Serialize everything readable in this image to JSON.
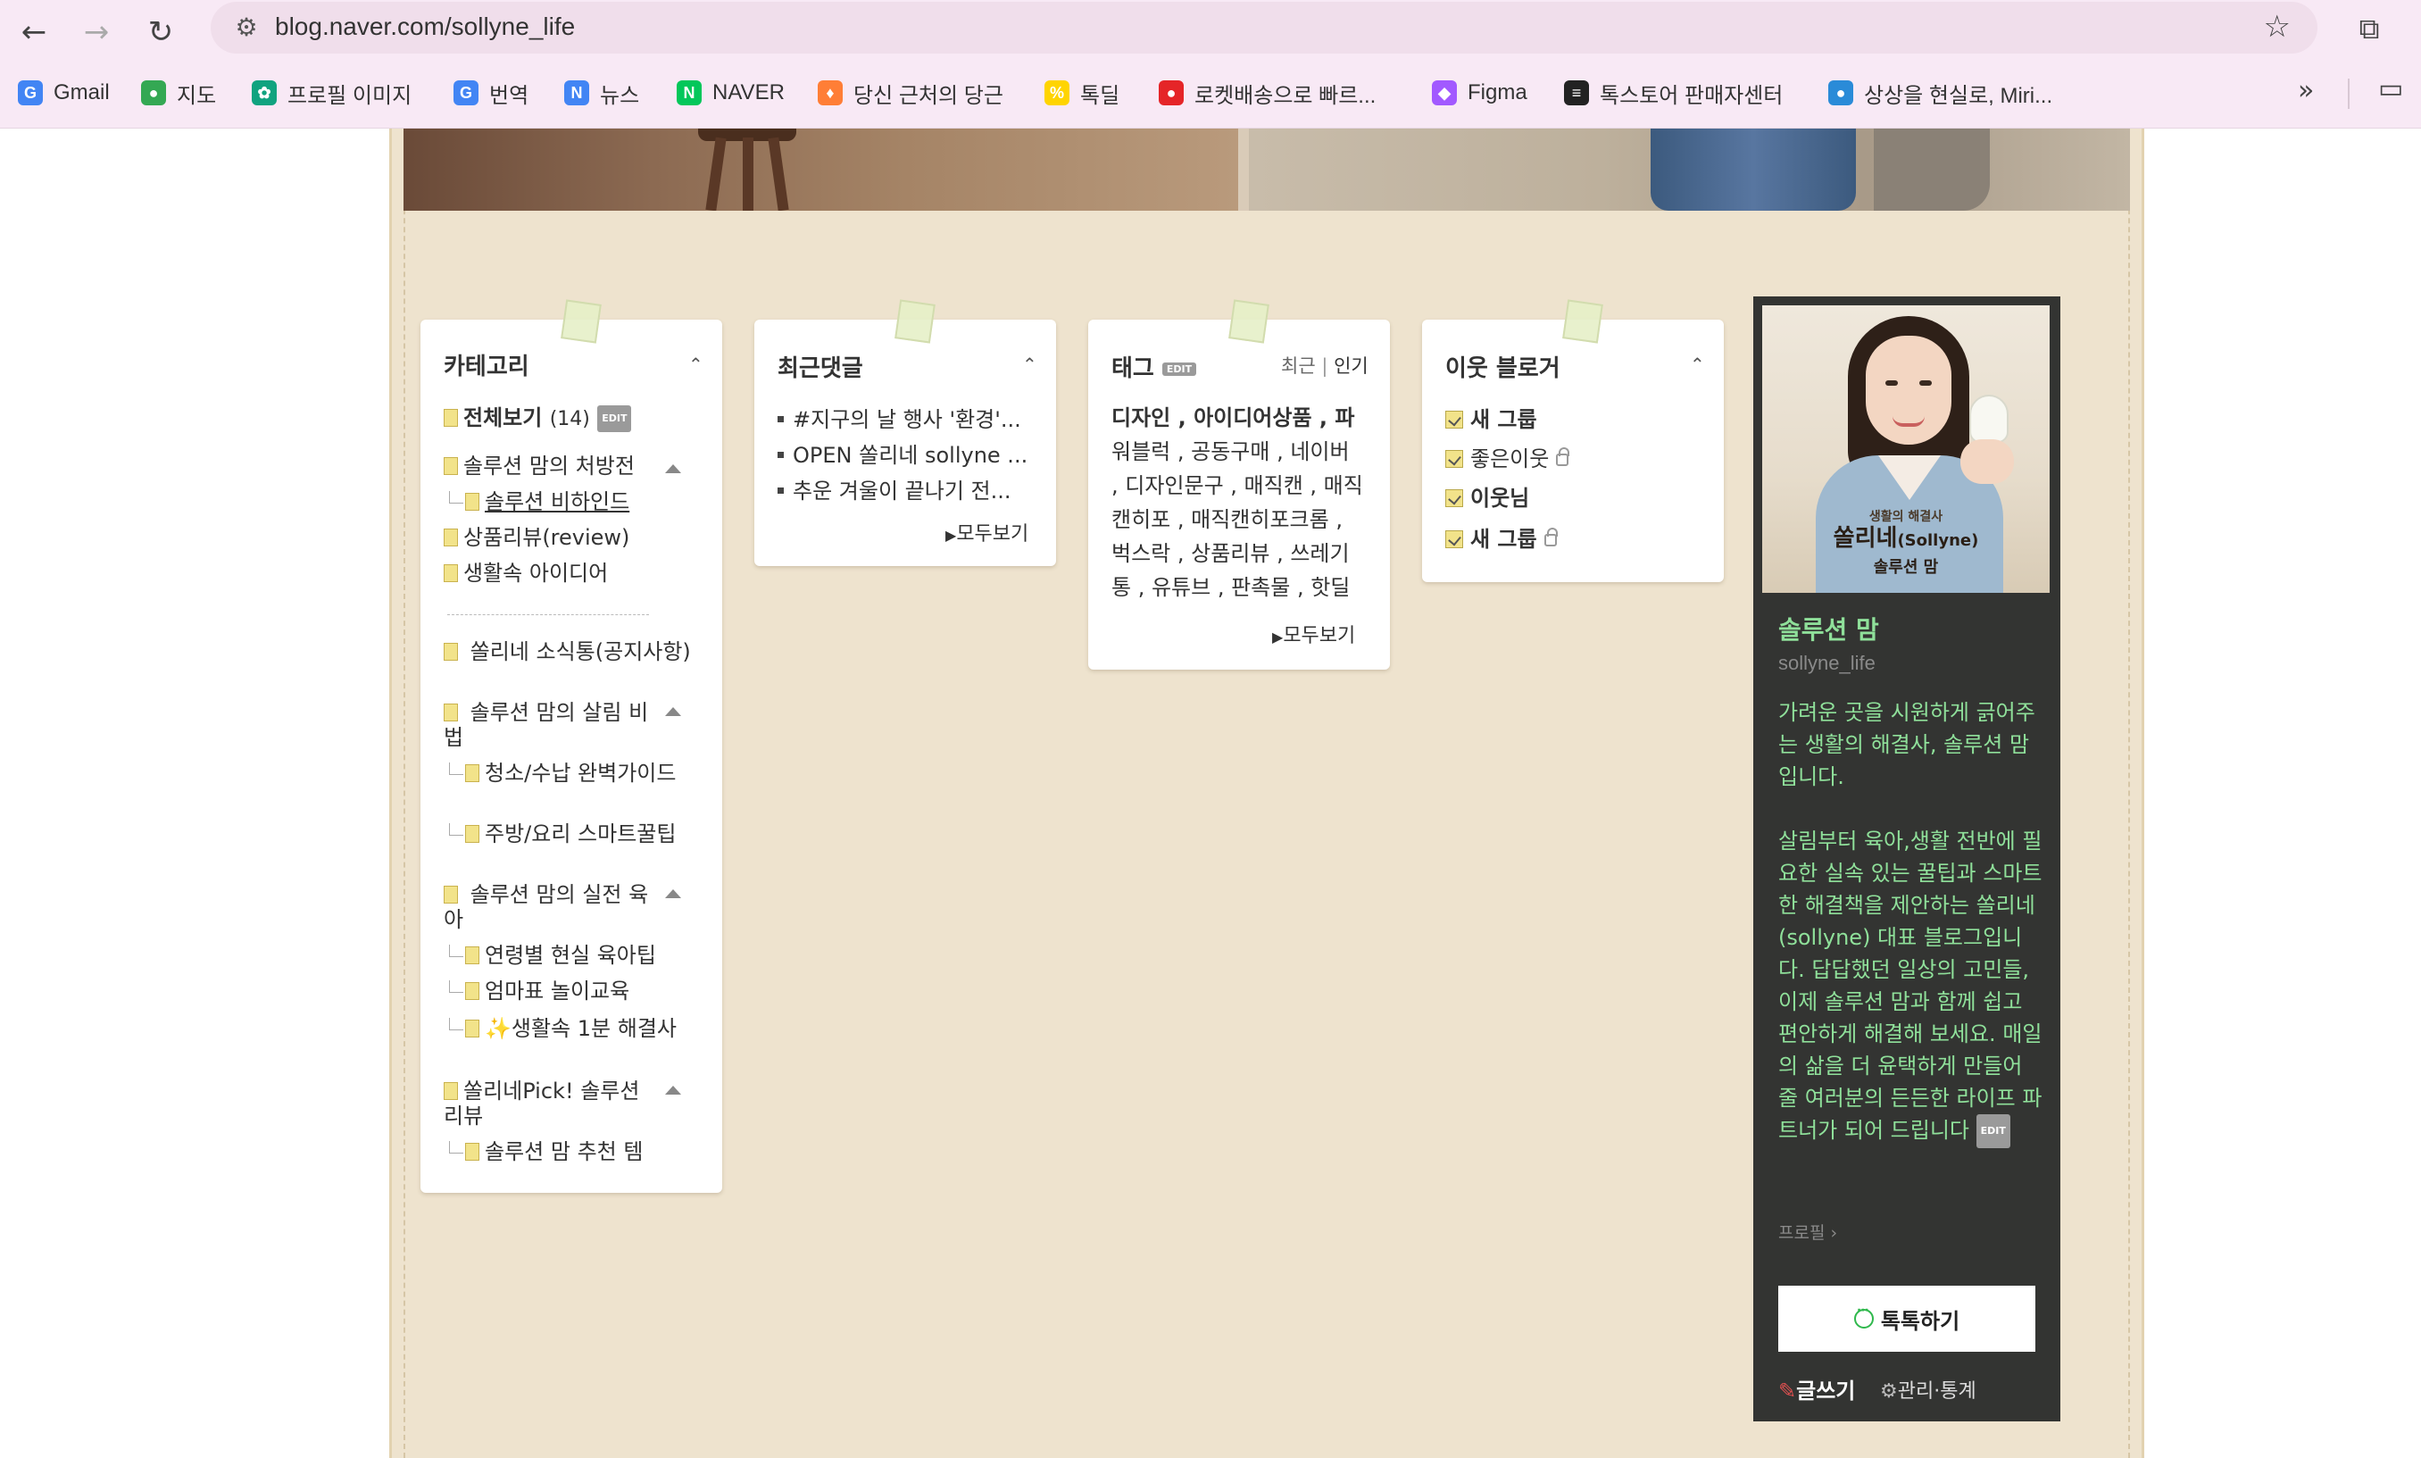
{
  "browser": {
    "url": "blog.naver.com/sollyne_life",
    "bookmarks": [
      {
        "label": "Gmail",
        "icon": "google-icon",
        "color": "#4285f4",
        "glyph": "G"
      },
      {
        "label": "지도",
        "icon": "maps-pin-icon",
        "color": "#34a853",
        "glyph": "●"
      },
      {
        "label": "프로필 이미지",
        "icon": "chatgpt-icon",
        "color": "#10a37f",
        "glyph": "✿"
      },
      {
        "label": "번역",
        "icon": "translate-icon",
        "color": "#4285f4",
        "glyph": "G"
      },
      {
        "label": "뉴스",
        "icon": "news-icon",
        "color": "#4285f4",
        "glyph": "N"
      },
      {
        "label": "NAVER",
        "icon": "naver-icon",
        "color": "#03c75a",
        "glyph": "N"
      },
      {
        "label": "당신 근처의 당근",
        "icon": "carrot-icon",
        "color": "#ff7e36",
        "glyph": "♦"
      },
      {
        "label": "톡딜",
        "icon": "tokdeal-icon",
        "color": "#ffd400",
        "glyph": "%"
      },
      {
        "label": "로켓배송으로 빠르...",
        "icon": "coupang-icon",
        "color": "#e52528",
        "glyph": "●"
      },
      {
        "label": "Figma",
        "icon": "figma-icon",
        "color": "#a259ff",
        "glyph": "◆"
      },
      {
        "label": "톡스토어 판매자센터",
        "icon": "talkstore-icon",
        "color": "#222222",
        "glyph": "≡"
      },
      {
        "label": "상상을 현실로, Miri...",
        "icon": "globe-icon",
        "color": "#2a8bd8",
        "glyph": "●"
      }
    ],
    "more_icon": "chevron-double-right-icon",
    "folder_icon": "folder-icon"
  },
  "category": {
    "title": "카테고리",
    "all_label": "전체보기",
    "all_count": "(14)",
    "edit": "EDIT",
    "items": [
      "솔루션 맘의 처방전",
      "솔루션 비하인드",
      "상품리뷰(review)",
      "생활속 아이디어",
      "쏠리네 소식통(공지사항)",
      "솔루션 맘의 살림 비법",
      "청소/수납 완벽가이드",
      "주방/요리 스마트꿀팁",
      "솔루션 맘의 실전 육아",
      "연령별 현실 육아팁",
      "엄마표 놀이교육",
      "생활속 1분 해결사",
      "쏠리네Pick! 솔루션 리뷰",
      "솔루션 맘 추천 템"
    ]
  },
  "comments": {
    "title": "최근댓글",
    "items": [
      "#지구의 날 행사 '환경'...",
      "OPEN 쏠리네 sollyne ...",
      "추운 겨울이 끝나기 전..."
    ],
    "more": "모두보기"
  },
  "tags": {
    "title": "태그",
    "edit": "EDIT",
    "tab_recent": "최근",
    "tab_sep": "|",
    "tab_popular": "인기",
    "lines": [
      "디자인 , 아이디어상품 , 파",
      "워블럭 , 공동구매 , 네이버",
      ", 디자인문구 , 매직캔 , 매직",
      "캔히포 , 매직캔히포크롬 ,",
      "벅스락 , 상품리뷰 , 쓰레기",
      "통 , 유튜브 , 판촉물 , 핫딜"
    ],
    "more": "모두보기"
  },
  "neighbors": {
    "title": "이웃 블로거",
    "items": [
      "새 그룹",
      "좋은이웃",
      "이웃님",
      "새 그룹"
    ]
  },
  "profile": {
    "img_sub": "생활의 해결사",
    "img_name": "쏠리네",
    "img_name_en": "(Sollyne)",
    "img_role": "솔루션 맘",
    "nickname": "솔루션 맘",
    "blog_id": "sollyne_life",
    "description": "가려운 곳을 시원하게 긁어주는 생활의 해결사, 솔루션 맘입니다.\n\n살림부터 육아,생활 전반에 필요한 실속 있는 꿀팁과 스마트한 해결책을 제안하는 쏠리네(sollyne) 대표 블로그입니다. 답답했던 일상의 고민들, 이제 솔루션 맘과 함께 쉽고 편안하게 해결해 보세요. 매일의 삶을 더 윤택하게 만들어 줄 여러분의 든든한 라이프 파트너가 되어 드립니다",
    "edit": "EDIT",
    "profile_link": "프로필",
    "talk_button": "톡톡하기",
    "write_label": "글쓰기",
    "manage_label": "관리·통계"
  }
}
